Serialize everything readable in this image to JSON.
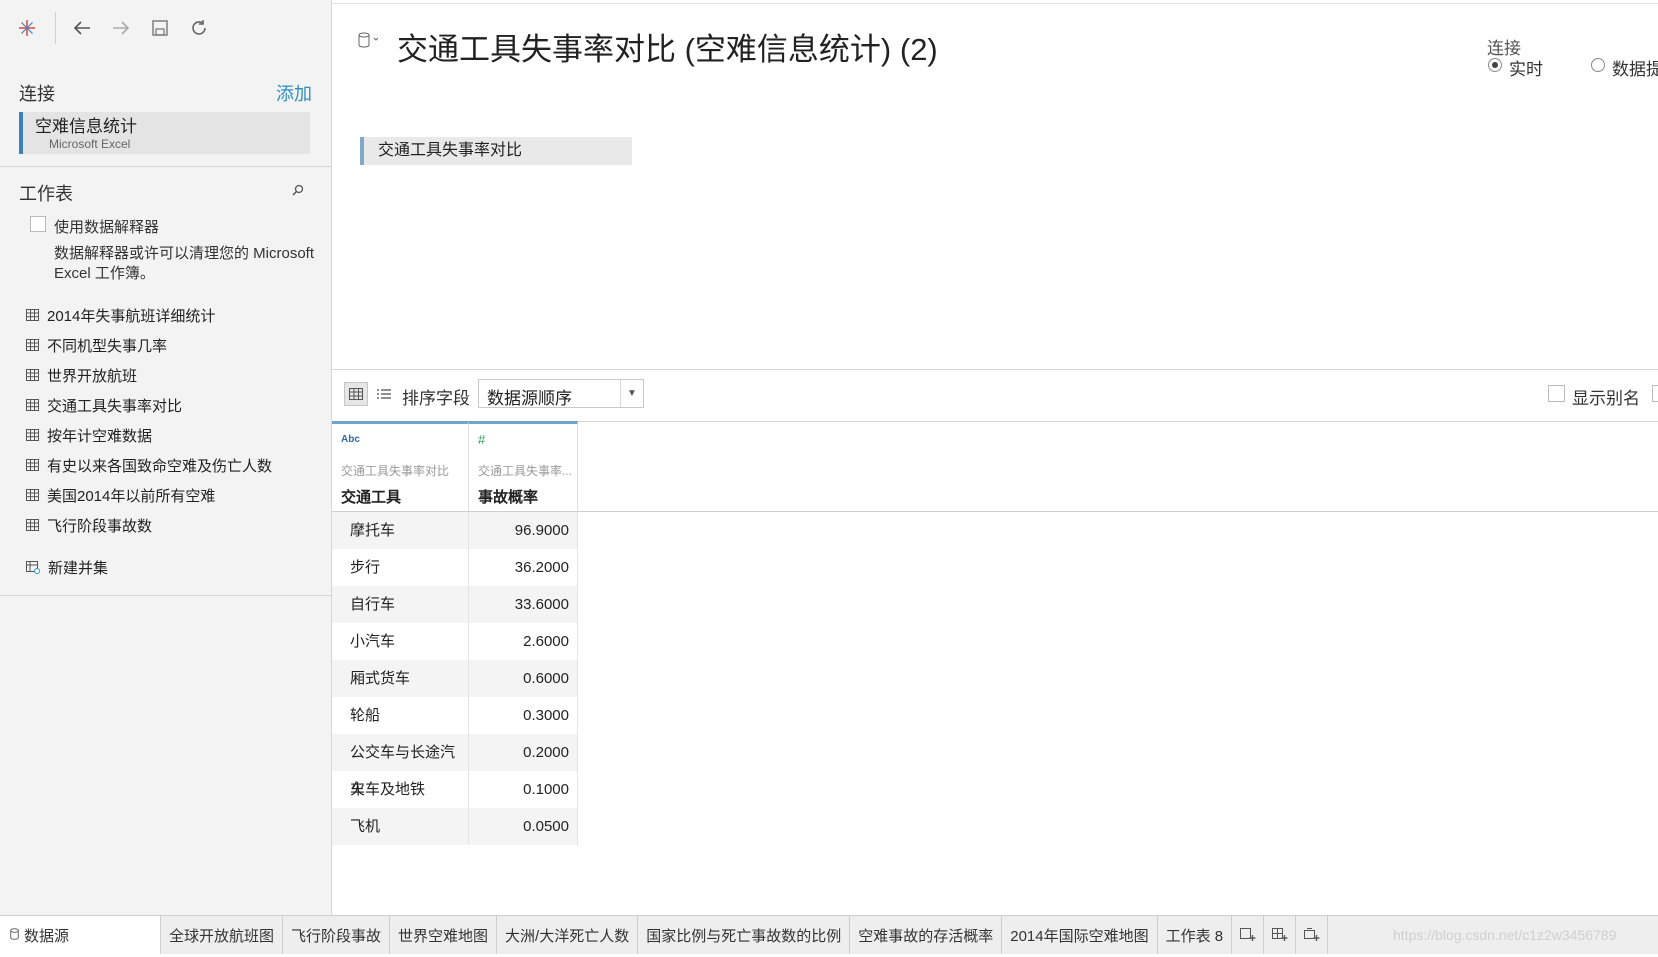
{
  "toolbar": {
    "icons": [
      "tableau-logo-icon",
      "back-arrow-icon",
      "forward-arrow-icon",
      "save-icon",
      "refresh-icon"
    ]
  },
  "sidebar": {
    "connections_title": "连接",
    "add_label": "添加",
    "connection": {
      "name": "空难信息统计",
      "type": "Microsoft Excel"
    },
    "worksheets_title": "工作表",
    "interpreter_label": "使用数据解释器",
    "interpreter_desc": "数据解释器或许可以清理您的 Microsoft Excel 工作簿。",
    "sheets": [
      "2014年失事航班详细统计",
      "不同机型失事几率",
      "世界开放航班",
      "交通工具失事率对比",
      "按年计空难数据",
      "有史以来各国致命空难及伤亡人数",
      "美国2014年以前所有空难",
      "飞行阶段事故数"
    ],
    "new_union": "新建并集"
  },
  "main": {
    "title": "交通工具失事率对比 (空难信息统计) (2)",
    "connection_label": "连接",
    "radio_live": "实时",
    "radio_extract": "数据提",
    "table_chip": "交通工具失事率对比"
  },
  "grid_toolbar": {
    "sort_label": "排序字段",
    "sort_value": "数据源顺序",
    "show_alias": "显示别名"
  },
  "grid": {
    "columns": [
      {
        "type": "Abc",
        "source": "交通工具失事率对比",
        "name": "交通工具"
      },
      {
        "type": "#",
        "source": "交通工具失事率...",
        "name": "事故概率"
      }
    ],
    "rows": [
      [
        "摩托车",
        "96.9000"
      ],
      [
        "步行",
        "36.2000"
      ],
      [
        "自行车",
        "33.6000"
      ],
      [
        "小汽车",
        "2.6000"
      ],
      [
        "厢式货车",
        "0.6000"
      ],
      [
        "轮船",
        "0.3000"
      ],
      [
        "公交车与长途汽车",
        "0.2000"
      ],
      [
        "火车及地铁",
        "0.1000"
      ],
      [
        "飞机",
        "0.0500"
      ]
    ]
  },
  "tabs": {
    "datasource": "数据源",
    "sheets": [
      "全球开放航班图",
      "飞行阶段事故",
      "世界空难地图",
      "大洲/大洋死亡人数",
      "国家比例与死亡事故数的比例",
      "空难事故的存活概率",
      "2014年国际空难地图",
      "工作表 8"
    ]
  },
  "watermark": "https://blog.csdn.net/c1z2w3456789",
  "colors": {
    "accent": "#2d8fc1",
    "header_bar": "#6fa4cd",
    "sidebar_bg": "#f3f3f3"
  }
}
